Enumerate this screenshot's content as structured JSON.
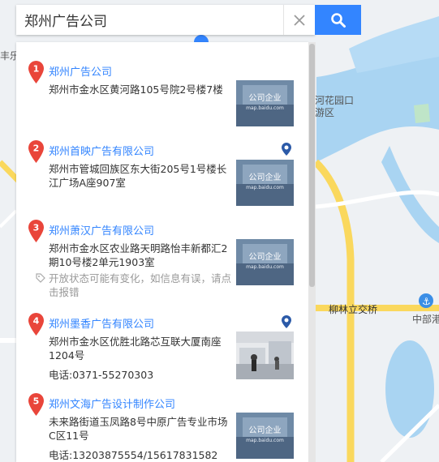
{
  "search": {
    "value": "郑州广告公司"
  },
  "map_labels": {
    "left": "丰乐",
    "park_1": "河花园口",
    "park_2": "游区",
    "interchange": "柳林立交桥",
    "port": "中部港"
  },
  "results": [
    {
      "index": "1",
      "title": "郑州广告公司",
      "address": "郑州市金水区黄河路105号院2号楼7楼",
      "has_marker": false
    },
    {
      "index": "2",
      "title": "郑州首映广告有限公司",
      "address": "郑州市管城回族区东大街205号1号楼长江广场A座907室",
      "has_marker": true
    },
    {
      "index": "3",
      "title": "郑州萧汉广告有限公司",
      "address": "郑州市金水区农业路天明路怡丰新都汇2期10号楼2单元1903室",
      "note": "开放状态可能有变化，如信息有误，请点击报错",
      "has_marker": false
    },
    {
      "index": "4",
      "title": "郑州墨香广告有限公司",
      "address": "郑州市金水区优胜北路芯互联大厦南座1204号",
      "phone": "电话:0371-55270303",
      "has_marker": true
    },
    {
      "index": "5",
      "title": "郑州文海广告设计制作公司",
      "address": "未来路街道玉凤路8号中原广告专业市场C区11号",
      "phone": "电话:13203875554/15617831582",
      "has_marker": false
    }
  ],
  "thumb_caption": {
    "main": "公司企业",
    "sub": "map.baidu.com"
  },
  "colors": {
    "accent": "#3385ff",
    "pin": "#e9453a",
    "water": "#a9d4f2",
    "road": "#fad85d",
    "map_bg": "#eef1f4"
  }
}
